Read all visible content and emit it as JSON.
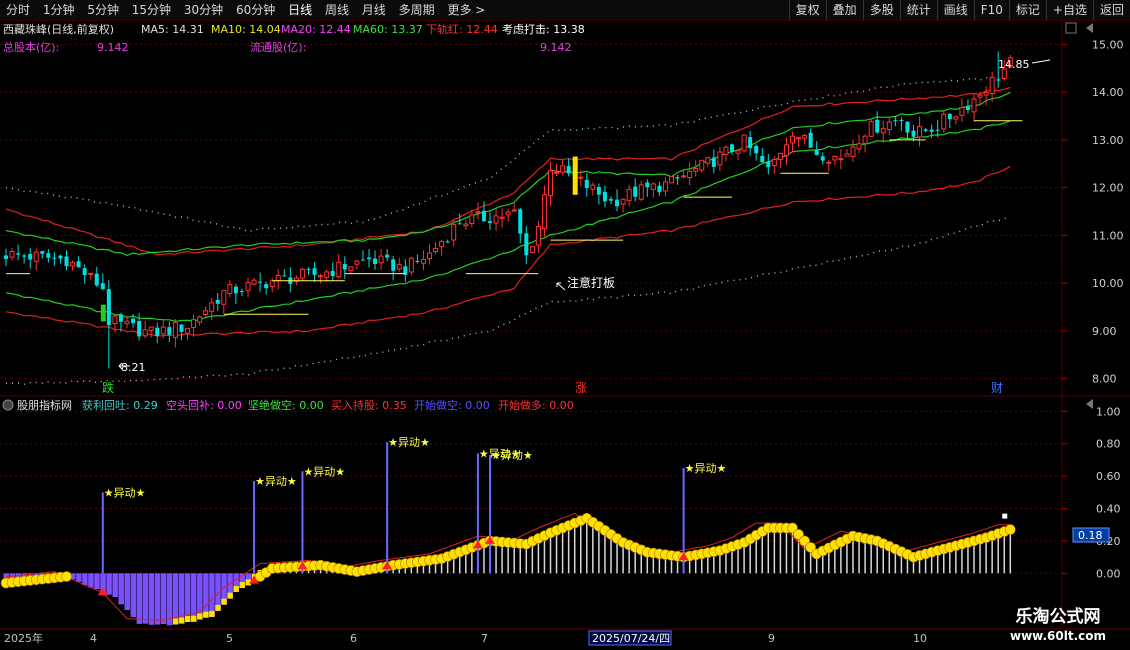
{
  "toolbar": {
    "periods": [
      "分时",
      "1分钟",
      "5分钟",
      "15分钟",
      "30分钟",
      "60分钟",
      "日线",
      "周线",
      "月线",
      "多周期",
      "更多 >"
    ],
    "active_period": "日线",
    "buttons": [
      "复权",
      "叠加",
      "多股",
      "统计",
      "画线",
      "F10",
      "标记",
      "+自选",
      "返回"
    ]
  },
  "main_header": {
    "stock": "西藏珠峰(日线,前复权)",
    "ma5": "MA5: 14.31",
    "ma10": "MA10: 14.04",
    "ma20": "MA20: 12.44",
    "ma60": "MA60: 13.37",
    "lower_rail": "下轨红: 12.44",
    "consider": "考虑打击: 13.38",
    "total_share_label": "总股本(亿):",
    "total_share_value": "9.142",
    "float_share_label": "流通股(亿):",
    "float_share_value": "9.142"
  },
  "annotations": {
    "high": "14.85",
    "low": "8.21",
    "note": "注意打板",
    "fall": "跌",
    "rise": "涨",
    "finance": "财",
    "signal": "★异动★"
  },
  "sub_header": {
    "title": "股朋指标网",
    "items": [
      {
        "text": "获利回吐: 0.29",
        "color": "#40d0d0"
      },
      {
        "text": "空头回补: 0.00",
        "color": "#ff40ff"
      },
      {
        "text": "坚绝做空: 0.00",
        "color": "#40e040"
      },
      {
        "text": "买入持股: 0.35",
        "color": "#ff3030"
      },
      {
        "text": "开始做空: 0.00",
        "color": "#5050ff"
      },
      {
        "text": "开始做多: 0.00",
        "color": "#ff3030"
      }
    ]
  },
  "current_value": "0.18",
  "x_labels": [
    "2025年",
    "4",
    "5",
    "6",
    "7",
    "2025/07/24/四",
    "9",
    "10"
  ],
  "watermark": {
    "name": "乐淘公式网",
    "url": "www.60lt.com"
  },
  "colors": {
    "up": "#ff3030",
    "down": "#00e0e0",
    "ma_green": "#20d020",
    "ma_red": "#e02020",
    "yellow": "#ffe000",
    "purple": "#7a50ff",
    "grid": "#5a0000"
  },
  "chart_data": [
    {
      "type": "candlestick",
      "title": "西藏珠峰(日线,前复权)",
      "ylim": [
        7.7,
        15.3
      ],
      "yticks": [
        8.0,
        9.0,
        10.0,
        11.0,
        12.0,
        13.0,
        14.0,
        15.0
      ],
      "axis_side": "right",
      "bars": 167,
      "close_path": [
        [
          0,
          10.6
        ],
        [
          10,
          10.5
        ],
        [
          16,
          9.9
        ],
        [
          17,
          9.2
        ],
        [
          24,
          8.95
        ],
        [
          30,
          9.1
        ],
        [
          36,
          9.8
        ],
        [
          44,
          10.05
        ],
        [
          52,
          10.2
        ],
        [
          60,
          10.5
        ],
        [
          66,
          10.3
        ],
        [
          70,
          10.6
        ],
        [
          75,
          11.3
        ],
        [
          84,
          11.45
        ],
        [
          86,
          10.55
        ],
        [
          88,
          11.2
        ],
        [
          90,
          12.45
        ],
        [
          94,
          12.2
        ],
        [
          100,
          11.7
        ],
        [
          104,
          11.9
        ],
        [
          110,
          12.1
        ],
        [
          116,
          12.5
        ],
        [
          122,
          12.95
        ],
        [
          126,
          12.35
        ],
        [
          130,
          13.2
        ],
        [
          134,
          12.75
        ],
        [
          138,
          12.6
        ],
        [
          142,
          13.2
        ],
        [
          148,
          13.45
        ],
        [
          150,
          13.1
        ],
        [
          154,
          13.3
        ],
        [
          160,
          13.85
        ],
        [
          166,
          14.6
        ]
      ],
      "ma_green_upper": [
        [
          0,
          11.1
        ],
        [
          20,
          10.6
        ],
        [
          40,
          10.8
        ],
        [
          60,
          10.9
        ],
        [
          70,
          11.1
        ],
        [
          84,
          11.7
        ],
        [
          90,
          12.35
        ],
        [
          110,
          12.25
        ],
        [
          130,
          13.25
        ],
        [
          160,
          13.7
        ],
        [
          166,
          14.0
        ]
      ],
      "ma_green_lower": [
        [
          0,
          9.8
        ],
        [
          20,
          9.3
        ],
        [
          30,
          9.2
        ],
        [
          50,
          9.65
        ],
        [
          70,
          10.1
        ],
        [
          84,
          10.7
        ],
        [
          90,
          11.0
        ],
        [
          110,
          11.7
        ],
        [
          130,
          12.75
        ],
        [
          160,
          13.2
        ],
        [
          166,
          13.4
        ]
      ],
      "band_red_upper": [
        [
          0,
          11.55
        ],
        [
          25,
          10.6
        ],
        [
          50,
          10.8
        ],
        [
          70,
          11.1
        ],
        [
          84,
          11.9
        ],
        [
          90,
          12.6
        ],
        [
          110,
          12.6
        ],
        [
          130,
          13.7
        ],
        [
          160,
          13.95
        ],
        [
          166,
          14.1
        ]
      ],
      "band_red_lower": [
        [
          0,
          9.4
        ],
        [
          25,
          8.9
        ],
        [
          50,
          9.0
        ],
        [
          70,
          9.4
        ],
        [
          84,
          9.9
        ],
        [
          90,
          10.8
        ],
        [
          110,
          11.1
        ],
        [
          130,
          11.7
        ],
        [
          150,
          11.9
        ],
        [
          160,
          12.1
        ],
        [
          166,
          12.45
        ]
      ],
      "dotted_upper": [
        [
          0,
          12.0
        ],
        [
          20,
          11.6
        ],
        [
          40,
          11.1
        ],
        [
          60,
          11.3
        ],
        [
          80,
          12.2
        ],
        [
          90,
          13.2
        ],
        [
          110,
          13.3
        ],
        [
          130,
          13.8
        ],
        [
          150,
          14.2
        ],
        [
          166,
          14.3
        ]
      ],
      "dotted_lower": [
        [
          0,
          7.9
        ],
        [
          20,
          7.95
        ],
        [
          40,
          8.1
        ],
        [
          60,
          8.5
        ],
        [
          80,
          9.0
        ],
        [
          90,
          9.6
        ],
        [
          110,
          9.8
        ],
        [
          130,
          10.3
        ],
        [
          150,
          10.8
        ],
        [
          166,
          11.4
        ]
      ],
      "high": 14.85,
      "low": 8.21
    },
    {
      "type": "bar",
      "title": "股朋指标网",
      "ylim": [
        -0.35,
        1.07
      ],
      "yticks": [
        0.0,
        0.2,
        0.4,
        0.6,
        0.8,
        1.0
      ],
      "axis_side": "right",
      "series": [
        {
          "name": "获利回吐",
          "value": 0.29
        },
        {
          "name": "空头回补",
          "value": 0.0
        },
        {
          "name": "坚绝做空",
          "value": 0.0
        },
        {
          "name": "买入持股",
          "value": 0.35
        },
        {
          "name": "开始做空",
          "value": 0.0
        },
        {
          "name": "开始做多",
          "value": 0.0
        }
      ],
      "wave_path": [
        [
          0,
          -0.06
        ],
        [
          10,
          -0.02
        ],
        [
          18,
          -0.15
        ],
        [
          22,
          -0.31
        ],
        [
          28,
          -0.32
        ],
        [
          34,
          -0.27
        ],
        [
          38,
          -0.12
        ],
        [
          44,
          0.03
        ],
        [
          52,
          0.05
        ],
        [
          58,
          0.01
        ],
        [
          64,
          0.05
        ],
        [
          72,
          0.09
        ],
        [
          80,
          0.2
        ],
        [
          86,
          0.18
        ],
        [
          90,
          0.25
        ],
        [
          96,
          0.34
        ],
        [
          102,
          0.19
        ],
        [
          106,
          0.13
        ],
        [
          112,
          0.1
        ],
        [
          118,
          0.14
        ],
        [
          122,
          0.19
        ],
        [
          126,
          0.28
        ],
        [
          130,
          0.28
        ],
        [
          134,
          0.12
        ],
        [
          140,
          0.23
        ],
        [
          144,
          0.2
        ],
        [
          150,
          0.1
        ],
        [
          156,
          0.16
        ],
        [
          162,
          0.22
        ],
        [
          166,
          0.27
        ]
      ],
      "signal_spikes": [
        [
          16,
          0.5
        ],
        [
          41,
          0.57
        ],
        [
          49,
          0.63
        ],
        [
          63,
          0.81
        ],
        [
          78,
          0.74
        ],
        [
          80,
          0.73
        ],
        [
          112,
          0.65
        ]
      ],
      "current": 0.18
    }
  ]
}
